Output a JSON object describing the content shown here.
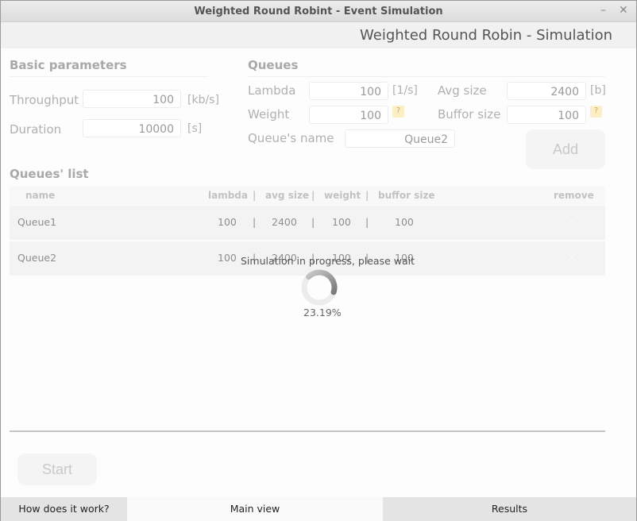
{
  "window": {
    "title": "Weighted Round Robint - Event Simulation",
    "minimize_glyph": "–",
    "close_glyph": "✕"
  },
  "header": {
    "app_title": "Weighted Round Robin - Simulation"
  },
  "basic_parameters": {
    "title": "Basic parameters",
    "throughput": {
      "label": "Throughput",
      "value": "100",
      "unit": "[kb/s]"
    },
    "duration": {
      "label": "Duration",
      "value": "10000",
      "unit": "[s]"
    }
  },
  "queues": {
    "title": "Queues",
    "lambda": {
      "label": "Lambda",
      "value": "100",
      "unit": "[1/s]"
    },
    "avg_size": {
      "label": "Avg size",
      "value": "2400",
      "unit": "[b]"
    },
    "weight": {
      "label": "Weight",
      "value": "100",
      "help": "?"
    },
    "buffor_size": {
      "label": "Buffor size",
      "value": "100",
      "help": "?"
    },
    "queue_name": {
      "label": "Queue's name",
      "value": "Queue2"
    },
    "add_label": "Add"
  },
  "queues_list": {
    "title": "Queues' list",
    "separator": "|",
    "columns": {
      "name": "name",
      "lambda": "lambda",
      "avg_size": "avg size",
      "weight": "weight",
      "buffor_size": "buffor size",
      "remove": "remove"
    },
    "rows": [
      {
        "name": "Queue1",
        "lambda": "100",
        "avg_size": "2400",
        "weight": "100",
        "buffor_size": "100"
      },
      {
        "name": "Queue2",
        "lambda": "100",
        "avg_size": "2400",
        "weight": "100",
        "buffor_size": "100"
      }
    ]
  },
  "simulation": {
    "status": "Simulation in progress, please wait",
    "progress_text": "23.19%",
    "progress": 0.2319
  },
  "start_label": "Start",
  "tabs": [
    {
      "label": "How does it work?",
      "active": false
    },
    {
      "label": "Main view",
      "active": true
    },
    {
      "label": "Results",
      "active": false
    }
  ],
  "colors": {
    "tab_inactive": "#e4e4e4",
    "tab_active": "#fafafa",
    "help_badge": "#fcefc6"
  }
}
